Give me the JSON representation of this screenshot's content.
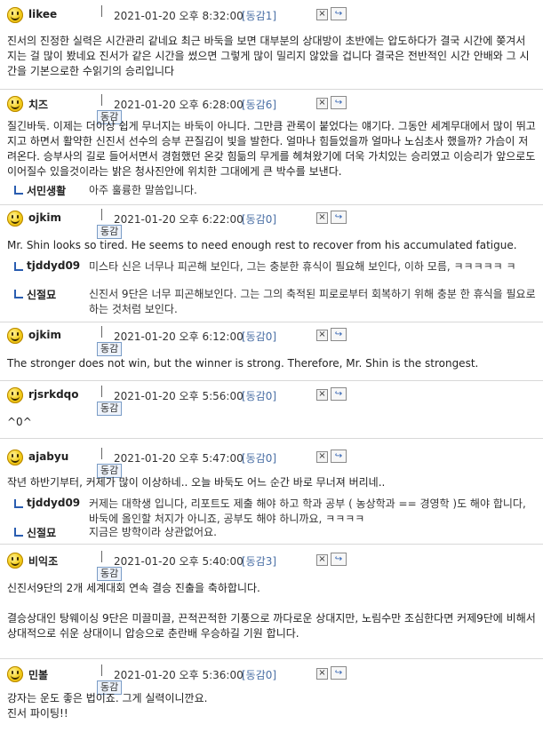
{
  "comments": [
    {
      "nick": "likee",
      "date": "2021-01-20 오후 8:32:00",
      "reply": "[동감1]",
      "rank": "",
      "text": "진서의 진정한 실력은 시간관리 같네요 최근 바둑을 보면 대부분의 상대방이 초반에는 압도하다가 결국 시간에 쫒겨서 지는 걸 많이 봤네요 진서가 같은 시간을 썼으면 그렇게 많이 밀리지 않았을 겁니다 결국은 전반적인 시간 안배와 그 시간을 기본으로한 수읽기의 승리입니다",
      "subs": []
    },
    {
      "nick": "치즈",
      "date": "2021-01-20 오후 6:28:00",
      "reply": "[동감6]",
      "rank": "동감",
      "text": "질긴바둑. 이제는 더이상 쉽게 무너지는 바둑이 아니다. 그만큼 관록이 붙었다는 얘기다. 그동안 세계무대에서 많이 뛰고 지고 하면서 활약한 신진서 선수의 승부 끈질김이 빛을 발한다. 얼마나 힘들었을까 얼마나 노심초사 했을까? 가슴이 저려온다. 승부사의 길로 들어서면서 경험했던 온갖 힘듦의 무게를 헤쳐왔기에 더욱 가치있는 승리였고 이승리가 앞으로도 이어질수 있을것이라는 밝은 청사진안에 위치한 그대에게 큰 박수를 보낸다.",
      "subs": [
        {
          "nick": "서민생활",
          "text": "아주 훌륭한 말씀입니다."
        }
      ]
    },
    {
      "nick": "ojkim",
      "date": "2021-01-20 오후 6:22:00",
      "reply": "[동감0]",
      "rank": "동감",
      "text": "Mr. Shin looks so tired. He seems to need enough rest to recover from his accumulated fatigue.",
      "subs": [
        {
          "nick": "tjddyd09",
          "text": "미스타 신은 너무나 피곤해 보인다, 그는 충분한 휴식이 필요해 보인다, 이하 모름, ㅋㅋㅋㅋㅋ ㅋ"
        },
        {
          "nick": "신절묘",
          "text": "신진서 9단은 너무 피곤해보인다. 그는 그의 축적된 피로로부터 회복하기 위해 충분 한 휴식을 필요로 하는 것처럼 보인다."
        }
      ]
    },
    {
      "nick": "ojkim",
      "date": "2021-01-20 오후 6:12:00",
      "reply": "[동감0]",
      "rank": "동감",
      "text": "The stronger does not win, but the winner is strong. Therefore, Mr. Shin is the strongest.",
      "subs": []
    },
    {
      "nick": "rjsrkdqo",
      "date": "2021-01-20 오후 5:56:00",
      "reply": "[동감0]",
      "rank": "동감",
      "text": "^0^",
      "subs": []
    },
    {
      "nick": "ajabyu",
      "date": "2021-01-20 오후 5:47:00",
      "reply": "[동감0]",
      "rank": "동감",
      "text": "작년 하반기부터, 커제가 많이 이상하네.. 오늘 바둑도 어느 순간 바로 무너져 버리네..",
      "subs": [
        {
          "nick": "tjddyd09",
          "text": "커제는 대학생 입니다, 리포트도 제출 해야 하고 학과 공부 ( 농상학과 == 경영학 )도 해야 합니다, 바둑에 올인할 처지가 아니죠, 공부도 해야 하니까요, ㅋㅋㅋㅋ"
        },
        {
          "nick": "신절묘",
          "text": "지금은 방학이라 상관없어요."
        }
      ]
    },
    {
      "nick": "비익조",
      "date": "2021-01-20 오후 5:40:00",
      "reply": "[동감3]",
      "rank": "동감",
      "text": "신진서9단의 2개 세계대회 연속 결승 진출을 축하합니다.\n\n결승상대인 탕웨이싱 9단은 미끌미끌, 끈적끈적한 기풍으로 까다로운 상대지만, 노림수만 조심한다면 커제9단에 비해서 상대적으로 쉬운 상대이니 압승으로 춘란배 우승하길 기원 합니다.",
      "subs": []
    },
    {
      "nick": "민볼",
      "date": "2021-01-20 오후 5:36:00",
      "reply": "[동감0]",
      "rank": "동감",
      "text": "강자는 운도 좋은 법이죠. 그게 실력이니깐요.\n진서 파이팅!!",
      "subs": []
    }
  ]
}
